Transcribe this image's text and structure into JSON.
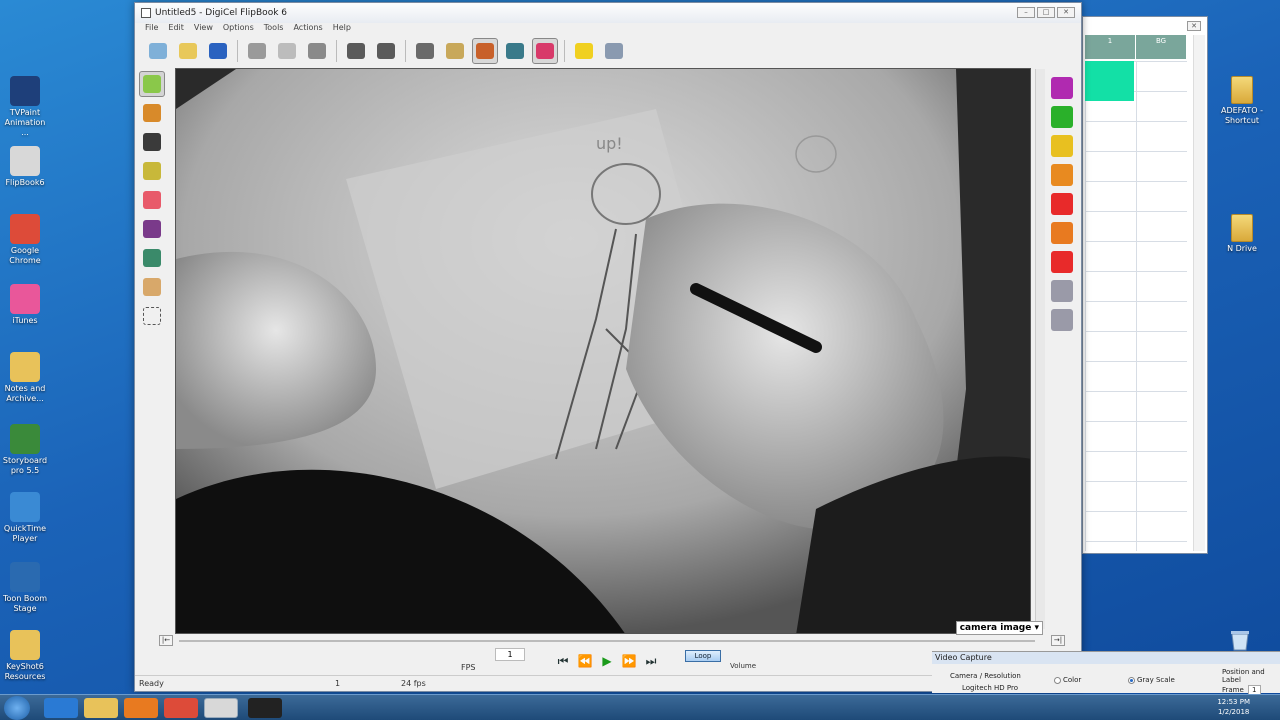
{
  "desktop": {
    "left_icons": [
      {
        "label": "TVPaint Animation ...",
        "icon": "tvpaint-icon",
        "color": "#1e3f7a"
      },
      {
        "label": "FlipBook6",
        "icon": "flipbook-icon",
        "color": "#d8d8d8"
      },
      {
        "label": "Google Chrome",
        "icon": "chrome-icon",
        "color": "#dd4b39"
      },
      {
        "label": "iTunes",
        "icon": "itunes-icon",
        "color": "#e9579a"
      },
      {
        "label": "Notes and Archive...",
        "icon": "folder-icon",
        "color": "#e8c25a"
      },
      {
        "label": "Storyboard pro 5.5",
        "icon": "storyboard-icon",
        "color": "#3a8a3a"
      },
      {
        "label": "QuickTime Player",
        "icon": "quicktime-icon",
        "color": "#3a8ad4"
      },
      {
        "label": "Toon Boom Stage",
        "icon": "toonboom-icon",
        "color": "#2a6ab0"
      },
      {
        "label": "KeyShot6 Resources",
        "icon": "folder-icon",
        "color": "#e8c25a"
      }
    ],
    "right_icons": [
      {
        "label": "ADEFATO - Shortcut",
        "icon": "folder-icon"
      },
      {
        "label": "N Drive",
        "icon": "folder-icon"
      }
    ]
  },
  "window": {
    "title": "Untitled5 - DigiCel FlipBook 6",
    "menu": [
      "File",
      "Edit",
      "View",
      "Options",
      "Tools",
      "Actions",
      "Help"
    ],
    "toolbar": [
      {
        "name": "new-scene-icon",
        "color": "#7fb0d8"
      },
      {
        "name": "open-icon",
        "color": "#e8c85a"
      },
      {
        "name": "save-icon",
        "color": "#2a62c0"
      },
      {
        "name": "cut-icon",
        "color": "#9a9a9a"
      },
      {
        "name": "copy-icon",
        "color": "#bcbcbc"
      },
      {
        "name": "paste-icon",
        "color": "#8a8a8a"
      },
      {
        "name": "undo-icon",
        "color": "#5a5a5a"
      },
      {
        "name": "redo-icon",
        "color": "#5a5a5a"
      },
      {
        "name": "light-table-icon",
        "color": "#6a6a6a"
      },
      {
        "name": "paint-bucket-icon",
        "color": "#c8a85a"
      },
      {
        "name": "palette-icon",
        "color": "#c8602a"
      },
      {
        "name": "camera-icon",
        "color": "#3a7a8a"
      },
      {
        "name": "capture-icon",
        "color": "#d83a6a"
      },
      {
        "name": "bulb-icon",
        "color": "#f0d020"
      },
      {
        "name": "settings-icon",
        "color": "#8a9ab0"
      }
    ],
    "left_tools": [
      {
        "name": "pencil-tool-icon",
        "color": "#8ac84a"
      },
      {
        "name": "brush-tool-icon",
        "color": "#d88a2a"
      },
      {
        "name": "pen-tool-icon",
        "color": "#3a3a3a"
      },
      {
        "name": "marker-tool-icon",
        "color": "#c8b83a"
      },
      {
        "name": "eraser-tool-icon",
        "color": "#e85a6a"
      },
      {
        "name": "ink-tool-icon",
        "color": "#7a3a8a"
      },
      {
        "name": "fill-tool-icon",
        "color": "#3a8a6a"
      },
      {
        "name": "hand-tool-icon",
        "color": "#d8a86a"
      },
      {
        "name": "select-tool-icon",
        "color": "#555555"
      }
    ],
    "right_tools": [
      {
        "name": "layers-icon",
        "color": "#b02ab0"
      },
      {
        "name": "move-icon",
        "color": "#2ab02a"
      },
      {
        "name": "scale-icon",
        "color": "#e8c020"
      },
      {
        "name": "rotate-icon",
        "color": "#e88a20"
      },
      {
        "name": "skew-icon",
        "color": "#e82a2a"
      },
      {
        "name": "reset-icon",
        "color": "#e87a20"
      },
      {
        "name": "delete-icon",
        "color": "#e82a2a"
      },
      {
        "name": "next-icon",
        "color": "#9a9aa8"
      },
      {
        "name": "prev-icon",
        "color": "#9a9aa8"
      }
    ],
    "canvas_label": "camera image",
    "fps_label": "FPS",
    "frame_value": "1",
    "loop_label": "Loop",
    "volume_label": "Volume",
    "status": {
      "ready": "Ready",
      "frame": "1",
      "fps": "24 fps"
    }
  },
  "xsheet": {
    "columns": [
      "1",
      "BG"
    ]
  },
  "capture_panel": {
    "title": "Video Capture",
    "camera_label": "Camera / Resolution",
    "camera_value": "Logitech HD Pro",
    "color_label": "Color",
    "grayscale_label": "Gray Scale",
    "position_label": "Position and Label",
    "frame_label": "Frame",
    "frame_value": "1"
  },
  "taskbar": {
    "time": "12:53 PM",
    "date": "1/2/2018"
  }
}
